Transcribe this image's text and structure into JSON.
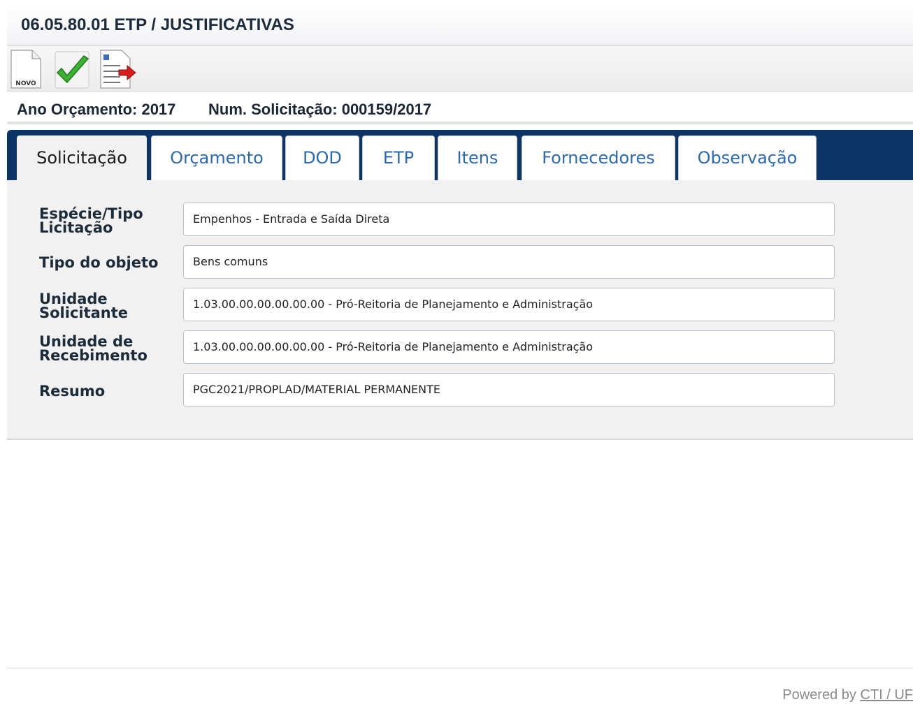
{
  "page": {
    "title": "06.05.80.01 ETP / JUSTIFICATIVAS"
  },
  "toolbar": {
    "buttons": [
      {
        "name": "new-document",
        "icon": "new-document-icon",
        "caption": "NOVO"
      },
      {
        "name": "confirm",
        "icon": "green-checkmark-icon"
      },
      {
        "name": "export-report",
        "icon": "document-arrow-icon"
      }
    ]
  },
  "info": {
    "ano_orcamento": "Ano Orçamento: 2017",
    "num_solicitacao": "Num. Solicitação: 000159/2017"
  },
  "tabs": [
    {
      "label": "Solicitação",
      "active": true
    },
    {
      "label": "Orçamento"
    },
    {
      "label": "DOD"
    },
    {
      "label": "ETP"
    },
    {
      "label": "Itens"
    },
    {
      "label": "Fornecedores"
    },
    {
      "label": "Observação"
    }
  ],
  "form": {
    "especie_tipo": {
      "label_line1": "Espécie/Tipo",
      "label_line2": "Licitação",
      "value": "Empenhos - Entrada e Saída Direta"
    },
    "tipo_objeto": {
      "label": "Tipo do objeto",
      "value": "Bens comuns"
    },
    "unidade_solicitante": {
      "label_line1": "Unidade",
      "label_line2": "Solicitante",
      "value": "1.03.00.00.00.00.00.00 - Pró-Reitoria de Planejamento e Administração"
    },
    "unidade_recebimento": {
      "label_line1": "Unidade de",
      "label_line2": "Recebimento",
      "value": "1.03.00.00.00.00.00.00 - Pró-Reitoria de Planejamento e Administração"
    },
    "resumo": {
      "label": "Resumo",
      "value": "PGC2021/PROPLAD/MATERIAL PERMANENTE"
    }
  },
  "footer": {
    "text": "Powered by ",
    "link": "CTI / UF"
  },
  "colors": {
    "tab_strip": "#0d3466",
    "tab_text": "#2b6ab0",
    "panel_bg": "#f1f1f1"
  }
}
